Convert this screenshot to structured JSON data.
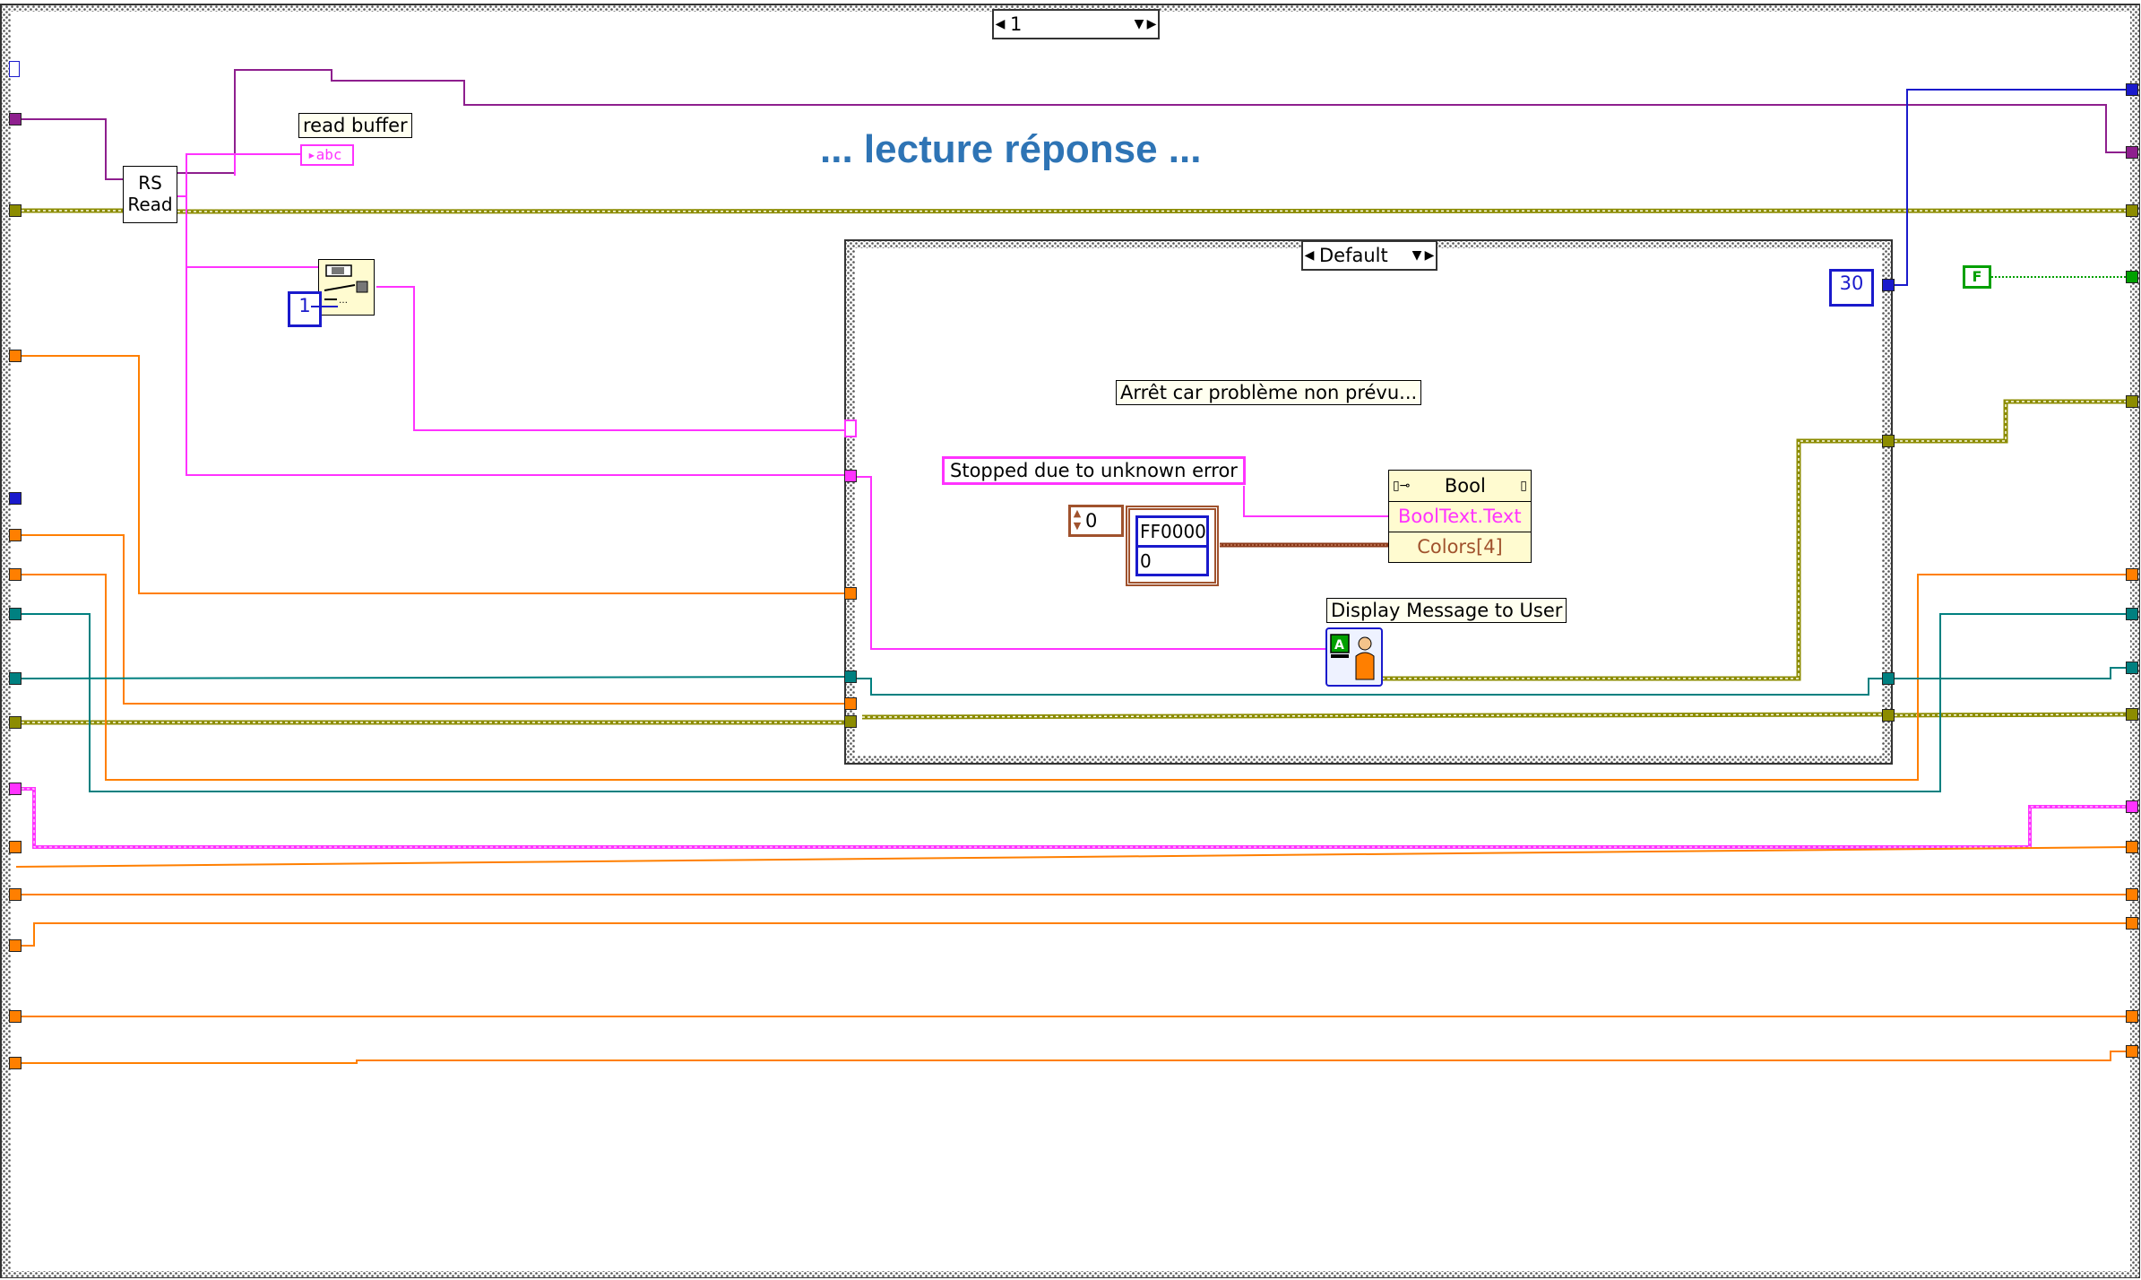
{
  "outer_case": {
    "selector_value": "1"
  },
  "inner_case": {
    "selector_value": "Default"
  },
  "annotation": {
    "title": "... lecture réponse ..."
  },
  "nodes": {
    "rs_read": {
      "line1": "RS",
      "line2": "Read"
    },
    "read_buffer_label": "read buffer",
    "read_buffer_indicator": "abc",
    "index_const": "1",
    "timeout_const": "30",
    "false_const": "F",
    "comment_fr": "Arrêt car problème non prévu...",
    "message_const": "Stopped due to unknown error",
    "numeric_const": "0",
    "color_cluster": {
      "value1": "FF0000",
      "value2": "0"
    },
    "property_node": {
      "class": "Bool",
      "prop1": "BoolText.Text",
      "prop2": "Colors[4]"
    },
    "display_message_label": "Display Message to User"
  },
  "colors": {
    "string_wire": "#ff33ff",
    "error_wire": "#8c8c00",
    "numeric_wire": "#ff7f00",
    "refnum_wire": "#008080",
    "int_wire": "#1a1acc",
    "bool_wire": "#00a000",
    "annotation_text": "#2e74b5"
  }
}
